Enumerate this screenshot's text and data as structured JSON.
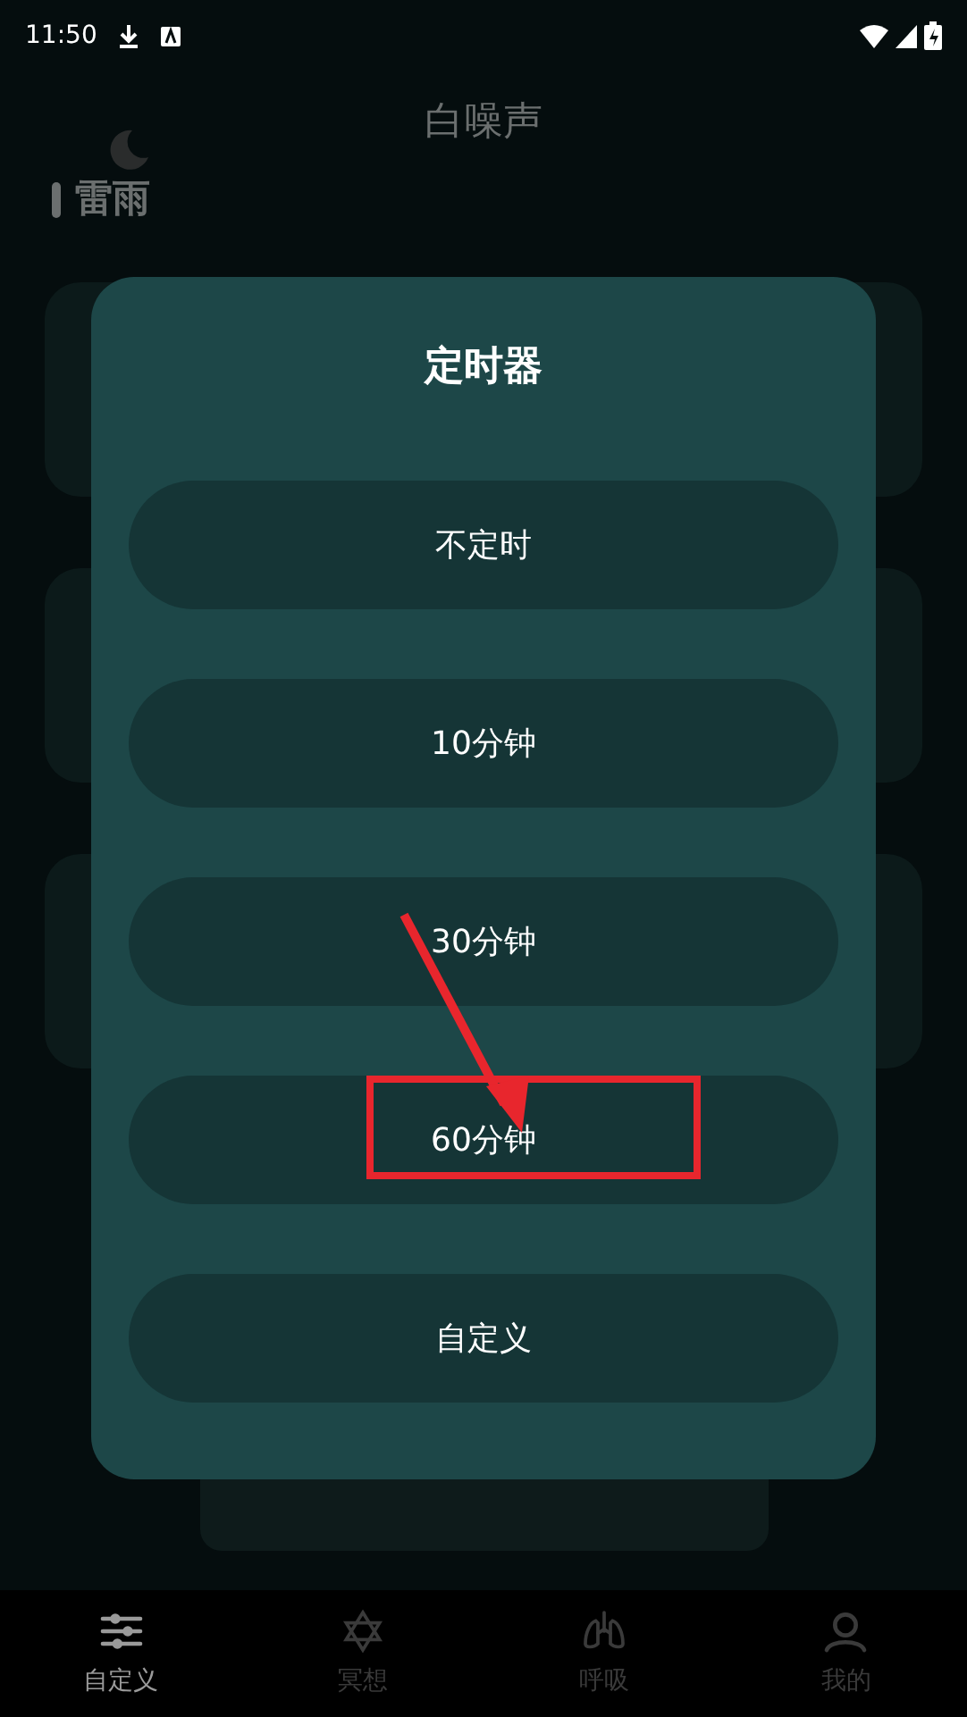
{
  "status_bar": {
    "time": "11:50"
  },
  "title": "白噪声",
  "section": {
    "title": "雷雨"
  },
  "dialog": {
    "title": "定时器",
    "options": [
      {
        "label": "不定时",
        "highlighted": false
      },
      {
        "label": "10分钟",
        "highlighted": false
      },
      {
        "label": "30分钟",
        "highlighted": false
      },
      {
        "label": "60分钟",
        "highlighted": true
      },
      {
        "label": "自定义",
        "highlighted": false
      }
    ]
  },
  "nav": [
    {
      "label": "自定义",
      "kind": "sliders",
      "selected": true
    },
    {
      "label": "冥想",
      "kind": "star",
      "selected": false
    },
    {
      "label": "呼吸",
      "kind": "lungs",
      "selected": false
    },
    {
      "label": "我的",
      "kind": "user",
      "selected": false
    }
  ]
}
